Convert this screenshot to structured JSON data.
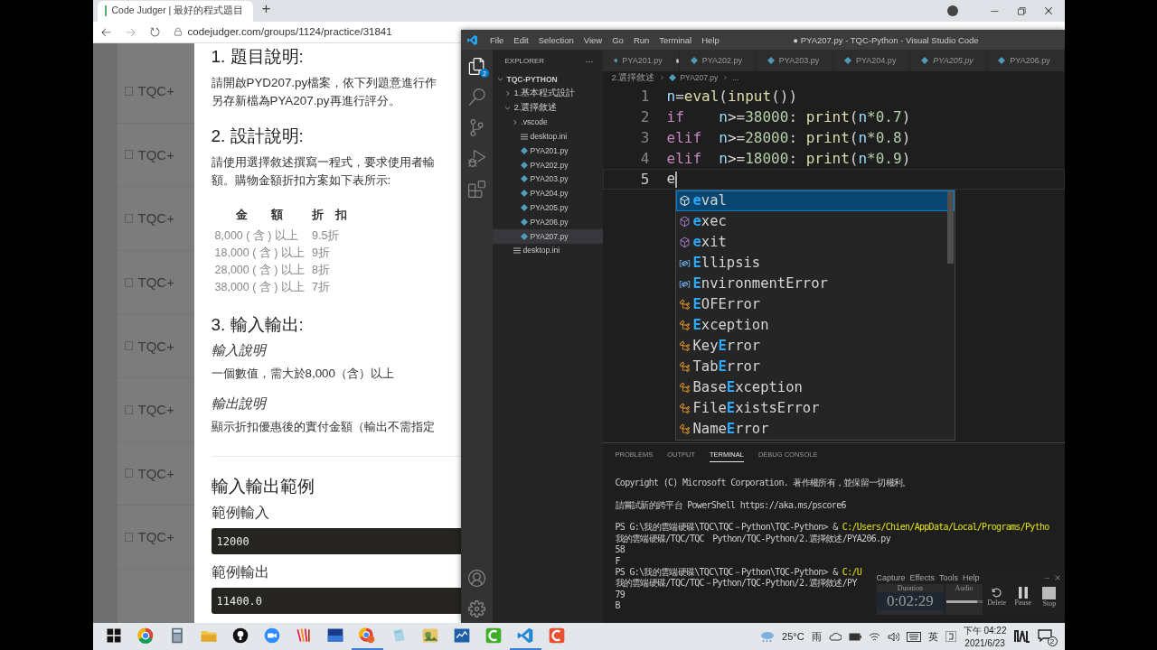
{
  "browser": {
    "tab_title": "Code Judger | 最好的程式題目",
    "new_tab": "+",
    "url": "codejudger.com/groups/1124/practice/31841"
  },
  "backdrop_items": [
    {
      "label": "TQC+"
    },
    {
      "label": "TQC+"
    },
    {
      "label": "TQC+"
    },
    {
      "label": "TQC+"
    },
    {
      "label": "TQC+"
    },
    {
      "label": "TQC+"
    },
    {
      "label": "TQC+"
    },
    {
      "label": "TQC+"
    }
  ],
  "problem": [
    {
      "kind": "heading",
      "text": "1. 題目說明:"
    },
    {
      "kind": "paragraph",
      "lines": [
        "請開啟PYD207.py檔案，依下列題意進行作",
        "另存新檔為PYA207.py再進行評分。"
      ]
    },
    {
      "kind": "heading",
      "text": "2. 設計說明:"
    },
    {
      "kind": "paragraph",
      "lines": [
        "請使用選擇敘述撰寫一程式，要求使用者輸",
        "額。購物金額折扣方案如下表所示:"
      ]
    },
    {
      "kind": "table",
      "columns": [
        "金　　額",
        "折　扣"
      ],
      "rows": [
        [
          "8,000 ( 含 ) 以上",
          "9.5折"
        ],
        [
          "18,000 ( 含 ) 以上",
          "9折"
        ],
        [
          "28,000 ( 含 ) 以上",
          "8折"
        ],
        [
          "38,000 ( 含 ) 以上",
          "7折"
        ]
      ]
    },
    {
      "kind": "heading",
      "text": "3. 輸入輸出:"
    },
    {
      "kind": "caption",
      "text": "輸入說明"
    },
    {
      "kind": "paragraph",
      "lines": [
        "一個數值，需大於8,000（含）以上"
      ]
    },
    {
      "kind": "caption",
      "text": "輸出說明"
    },
    {
      "kind": "paragraph",
      "lines": [
        "顯示折扣優惠後的實付金額（輸出不需指定"
      ]
    },
    {
      "kind": "rule"
    },
    {
      "kind": "title",
      "text": "輸入輸出範例"
    },
    {
      "kind": "label",
      "text": "範例輸入"
    },
    {
      "kind": "code",
      "text": "12000"
    },
    {
      "kind": "label",
      "text": "範例輸出"
    },
    {
      "kind": "code",
      "text": "11400.0"
    }
  ],
  "vscode": {
    "title": "● PYA207.py - TQC-Python - Visual Studio Code",
    "menu": [
      "File",
      "Edit",
      "Selection",
      "View",
      "Go",
      "Run",
      "Terminal",
      "Help"
    ],
    "activity": [
      {
        "kind": "files",
        "selected": true,
        "badge": "2"
      },
      {
        "kind": "search",
        "selected": false
      },
      {
        "kind": "source-control",
        "selected": false
      },
      {
        "kind": "run",
        "selected": false
      },
      {
        "kind": "extensions",
        "selected": false
      }
    ],
    "activity_bottom": [
      {
        "kind": "account"
      },
      {
        "kind": "settings"
      }
    ],
    "explorer": {
      "title": "EXPLORER",
      "more": "···",
      "tree": [
        {
          "label": "TQC-PYTHON",
          "kind": "root",
          "expanded": true,
          "selected": false,
          "children": [
            {
              "label": "1.基本程式設計",
              "kind": "folder",
              "expanded": false,
              "selected": false
            },
            {
              "label": "2.選擇敘述",
              "kind": "folder",
              "expanded": true,
              "selected": false,
              "children": [
                {
                  "label": ".vscode",
                  "kind": "folder",
                  "expanded": false,
                  "selected": false
                },
                {
                  "label": "desktop.ini",
                  "kind": "ini",
                  "selected": false
                },
                {
                  "label": "PYA201.py",
                  "kind": "python",
                  "selected": false
                },
                {
                  "label": "PYA202.py",
                  "kind": "python",
                  "selected": false
                },
                {
                  "label": "PYA203.py",
                  "kind": "python",
                  "selected": false
                },
                {
                  "label": "PYA204.py",
                  "kind": "python",
                  "selected": false
                },
                {
                  "label": "PYA205.py",
                  "kind": "python",
                  "selected": false
                },
                {
                  "label": "PYA206.py",
                  "kind": "python",
                  "selected": false
                },
                {
                  "label": "PYA207.py",
                  "kind": "python",
                  "selected": true
                }
              ]
            },
            {
              "label": "desktop.ini",
              "kind": "ini",
              "selected": false
            }
          ]
        }
      ]
    },
    "tabs": [
      {
        "label": "PYA201.py",
        "modified": true,
        "preview": false,
        "selected": false
      },
      {
        "label": "PYA202.py",
        "modified": false,
        "preview": false,
        "selected": false
      },
      {
        "label": "PYA203.py",
        "modified": false,
        "preview": false,
        "selected": false
      },
      {
        "label": "PYA204.py",
        "modified": false,
        "preview": false,
        "selected": false
      },
      {
        "label": "PYA205.py",
        "modified": false,
        "preview": true,
        "selected": false
      },
      {
        "label": "PYA206.py",
        "modified": false,
        "preview": false,
        "selected": false
      }
    ],
    "breadcrumb": [
      "2.選擇敘述",
      "PYA207.py",
      "..."
    ],
    "lines": [
      {
        "number": "1",
        "current": false,
        "tokens": [
          {
            "t": "n",
            "color": "#9cdcfe"
          },
          {
            "t": "=",
            "color": "#d4d4d4"
          },
          {
            "t": "eval",
            "color": "#dcdcaa"
          },
          {
            "t": "(",
            "color": "#d4d4d4"
          },
          {
            "t": "input",
            "color": "#dcdcaa"
          },
          {
            "t": "())",
            "color": "#d4d4d4"
          }
        ]
      },
      {
        "number": "2",
        "current": false,
        "tokens": [
          {
            "t": "if    ",
            "color": "#c586c0"
          },
          {
            "t": "n",
            "color": "#9cdcfe"
          },
          {
            "t": ">=",
            "color": "#d4d4d4"
          },
          {
            "t": "38000",
            "color": "#b5cea8"
          },
          {
            "t": ": ",
            "color": "#d4d4d4"
          },
          {
            "t": "print",
            "color": "#dcdcaa"
          },
          {
            "t": "(",
            "color": "#d4d4d4"
          },
          {
            "t": "n",
            "color": "#9cdcfe"
          },
          {
            "t": "*0.7",
            "color": "#b5cea8"
          },
          {
            "t": ")",
            "color": "#d4d4d4"
          }
        ]
      },
      {
        "number": "3",
        "current": false,
        "tokens": [
          {
            "t": "elif  ",
            "color": "#c586c0"
          },
          {
            "t": "n",
            "color": "#9cdcfe"
          },
          {
            "t": ">=",
            "color": "#d4d4d4"
          },
          {
            "t": "28000",
            "color": "#b5cea8"
          },
          {
            "t": ": ",
            "color": "#d4d4d4"
          },
          {
            "t": "print",
            "color": "#dcdcaa"
          },
          {
            "t": "(",
            "color": "#d4d4d4"
          },
          {
            "t": "n",
            "color": "#9cdcfe"
          },
          {
            "t": "*0.8",
            "color": "#b5cea8"
          },
          {
            "t": ")",
            "color": "#d4d4d4"
          }
        ]
      },
      {
        "number": "4",
        "current": false,
        "tokens": [
          {
            "t": "elif  ",
            "color": "#c586c0"
          },
          {
            "t": "n",
            "color": "#9cdcfe"
          },
          {
            "t": ">=",
            "color": "#d4d4d4"
          },
          {
            "t": "18000",
            "color": "#b5cea8"
          },
          {
            "t": ": ",
            "color": "#d4d4d4"
          },
          {
            "t": "print",
            "color": "#dcdcaa"
          },
          {
            "t": "(",
            "color": "#d4d4d4"
          },
          {
            "t": "n",
            "color": "#9cdcfe"
          },
          {
            "t": "*0.9",
            "color": "#b5cea8"
          },
          {
            "t": ")",
            "color": "#d4d4d4"
          }
        ]
      },
      {
        "number": "5",
        "current": true,
        "tokens": [
          {
            "t": "e",
            "color": "#d4d4d4"
          }
        ]
      }
    ],
    "suggestions": [
      {
        "kind": "function",
        "match": "e",
        "after": "val",
        "selected": true
      },
      {
        "kind": "function",
        "match": "e",
        "after": "xec",
        "selected": false
      },
      {
        "kind": "function",
        "match": "e",
        "after": "xit",
        "selected": false
      },
      {
        "kind": "variable",
        "match": "E",
        "after": "llipsis",
        "selected": false
      },
      {
        "kind": "variable",
        "match": "E",
        "after": "nvironmentError",
        "selected": false
      },
      {
        "kind": "class",
        "match": "E",
        "after": "OFError",
        "selected": false
      },
      {
        "kind": "class",
        "match": "E",
        "after": "xception",
        "selected": false
      },
      {
        "kind": "class",
        "before": "Key",
        "match": "E",
        "after": "rror",
        "selected": false
      },
      {
        "kind": "class",
        "before": "Tab",
        "match": "E",
        "after": "rror",
        "selected": false
      },
      {
        "kind": "class",
        "before": "Base",
        "match": "E",
        "after": "xception",
        "selected": false
      },
      {
        "kind": "class",
        "before": "File",
        "match": "E",
        "after": "xistsError",
        "selected": false
      },
      {
        "kind": "class",
        "before": "Name",
        "match": "E",
        "after": "rror",
        "selected": false
      }
    ],
    "panel_tabs": [
      {
        "label": "PROBLEMS",
        "selected": false
      },
      {
        "label": "OUTPUT",
        "selected": false
      },
      {
        "label": "TERMINAL",
        "selected": true
      },
      {
        "label": "DEBUG CONSOLE",
        "selected": false
      }
    ],
    "terminal": [
      {
        "lines": [
          {
            "text": "Copyright (C) Microsoft Corporation. 著作權所有，並保留一切權利。"
          }
        ]
      },
      {
        "lines": [
          {
            "text": "請嘗試新的跨平台 PowerShell https://aka.ms/pscore6"
          }
        ]
      },
      {
        "lines": [
          {
            "text": "PS G:\\我的雲端硬碟\\TQC\\TQC－Python\\TQC-Python> & ",
            "path": "C:/Users/Chien/AppData/Local/Programs/Pytho"
          },
          {
            "text": "我的雲端硬碟/TQC/TQC　Python/TQC-Python/2.選擇敘述/PYA206.py"
          },
          {
            "text": "58"
          },
          {
            "text": "F"
          },
          {
            "text": "PS G:\\我的雲端硬碟\\TQC\\TQC－Python\\TQC-Python> & ",
            "path": "C:/U"
          },
          {
            "text": "我的雲端硬碟/TQC/TQC－Python/TQC-Python/2.選擇敘述/PY"
          },
          {
            "text": "79"
          },
          {
            "text": "B"
          }
        ]
      }
    ]
  },
  "recorder": {
    "menu": [
      "Capture",
      "Effects",
      "Tools",
      "Help"
    ],
    "duration_label": "Duration",
    "duration": "0:02:29",
    "audio_label": "Audio",
    "audio": {
      "level": 0.85
    },
    "buttons": [
      {
        "kind": "delete",
        "label": "Delete"
      },
      {
        "kind": "pause",
        "label": "Pause"
      },
      {
        "kind": "stop",
        "label": "Stop"
      }
    ]
  },
  "taskbar": {
    "apps": [
      {
        "kind": "start",
        "running": false
      },
      {
        "kind": "chrome",
        "running": false
      },
      {
        "kind": "calculator",
        "running": false
      },
      {
        "kind": "folder",
        "running": false
      },
      {
        "kind": "bulb",
        "running": false
      },
      {
        "kind": "camera",
        "running": false
      },
      {
        "kind": "stripes",
        "running": false
      },
      {
        "kind": "dev",
        "running": false
      },
      {
        "kind": "chrome-profile",
        "running": true
      },
      {
        "kind": "notepad",
        "running": false
      },
      {
        "kind": "photo",
        "running": false
      },
      {
        "kind": "monitor",
        "running": false
      },
      {
        "kind": "green-c",
        "running": false
      },
      {
        "kind": "vscode",
        "running": true
      },
      {
        "kind": "red-c",
        "running": false
      }
    ],
    "temperature": "25°C",
    "weather": "雨",
    "ime": "英",
    "time": "下午 04:22",
    "date": "2021/6/23",
    "notifications": "2"
  }
}
